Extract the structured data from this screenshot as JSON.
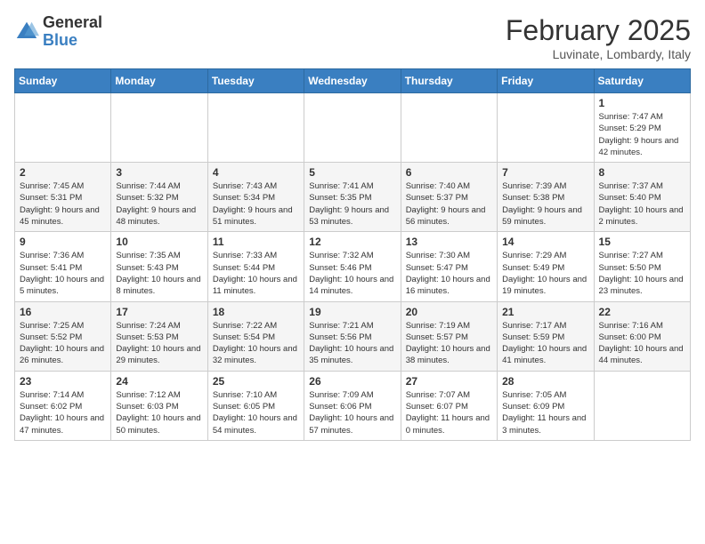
{
  "header": {
    "logo_general": "General",
    "logo_blue": "Blue",
    "title": "February 2025",
    "subtitle": "Luvinate, Lombardy, Italy"
  },
  "weekdays": [
    "Sunday",
    "Monday",
    "Tuesday",
    "Wednesday",
    "Thursday",
    "Friday",
    "Saturday"
  ],
  "weeks": [
    [
      {
        "day": "",
        "info": ""
      },
      {
        "day": "",
        "info": ""
      },
      {
        "day": "",
        "info": ""
      },
      {
        "day": "",
        "info": ""
      },
      {
        "day": "",
        "info": ""
      },
      {
        "day": "",
        "info": ""
      },
      {
        "day": "1",
        "info": "Sunrise: 7:47 AM\nSunset: 5:29 PM\nDaylight: 9 hours and 42 minutes."
      }
    ],
    [
      {
        "day": "2",
        "info": "Sunrise: 7:45 AM\nSunset: 5:31 PM\nDaylight: 9 hours and 45 minutes."
      },
      {
        "day": "3",
        "info": "Sunrise: 7:44 AM\nSunset: 5:32 PM\nDaylight: 9 hours and 48 minutes."
      },
      {
        "day": "4",
        "info": "Sunrise: 7:43 AM\nSunset: 5:34 PM\nDaylight: 9 hours and 51 minutes."
      },
      {
        "day": "5",
        "info": "Sunrise: 7:41 AM\nSunset: 5:35 PM\nDaylight: 9 hours and 53 minutes."
      },
      {
        "day": "6",
        "info": "Sunrise: 7:40 AM\nSunset: 5:37 PM\nDaylight: 9 hours and 56 minutes."
      },
      {
        "day": "7",
        "info": "Sunrise: 7:39 AM\nSunset: 5:38 PM\nDaylight: 9 hours and 59 minutes."
      },
      {
        "day": "8",
        "info": "Sunrise: 7:37 AM\nSunset: 5:40 PM\nDaylight: 10 hours and 2 minutes."
      }
    ],
    [
      {
        "day": "9",
        "info": "Sunrise: 7:36 AM\nSunset: 5:41 PM\nDaylight: 10 hours and 5 minutes."
      },
      {
        "day": "10",
        "info": "Sunrise: 7:35 AM\nSunset: 5:43 PM\nDaylight: 10 hours and 8 minutes."
      },
      {
        "day": "11",
        "info": "Sunrise: 7:33 AM\nSunset: 5:44 PM\nDaylight: 10 hours and 11 minutes."
      },
      {
        "day": "12",
        "info": "Sunrise: 7:32 AM\nSunset: 5:46 PM\nDaylight: 10 hours and 14 minutes."
      },
      {
        "day": "13",
        "info": "Sunrise: 7:30 AM\nSunset: 5:47 PM\nDaylight: 10 hours and 16 minutes."
      },
      {
        "day": "14",
        "info": "Sunrise: 7:29 AM\nSunset: 5:49 PM\nDaylight: 10 hours and 19 minutes."
      },
      {
        "day": "15",
        "info": "Sunrise: 7:27 AM\nSunset: 5:50 PM\nDaylight: 10 hours and 23 minutes."
      }
    ],
    [
      {
        "day": "16",
        "info": "Sunrise: 7:25 AM\nSunset: 5:52 PM\nDaylight: 10 hours and 26 minutes."
      },
      {
        "day": "17",
        "info": "Sunrise: 7:24 AM\nSunset: 5:53 PM\nDaylight: 10 hours and 29 minutes."
      },
      {
        "day": "18",
        "info": "Sunrise: 7:22 AM\nSunset: 5:54 PM\nDaylight: 10 hours and 32 minutes."
      },
      {
        "day": "19",
        "info": "Sunrise: 7:21 AM\nSunset: 5:56 PM\nDaylight: 10 hours and 35 minutes."
      },
      {
        "day": "20",
        "info": "Sunrise: 7:19 AM\nSunset: 5:57 PM\nDaylight: 10 hours and 38 minutes."
      },
      {
        "day": "21",
        "info": "Sunrise: 7:17 AM\nSunset: 5:59 PM\nDaylight: 10 hours and 41 minutes."
      },
      {
        "day": "22",
        "info": "Sunrise: 7:16 AM\nSunset: 6:00 PM\nDaylight: 10 hours and 44 minutes."
      }
    ],
    [
      {
        "day": "23",
        "info": "Sunrise: 7:14 AM\nSunset: 6:02 PM\nDaylight: 10 hours and 47 minutes."
      },
      {
        "day": "24",
        "info": "Sunrise: 7:12 AM\nSunset: 6:03 PM\nDaylight: 10 hours and 50 minutes."
      },
      {
        "day": "25",
        "info": "Sunrise: 7:10 AM\nSunset: 6:05 PM\nDaylight: 10 hours and 54 minutes."
      },
      {
        "day": "26",
        "info": "Sunrise: 7:09 AM\nSunset: 6:06 PM\nDaylight: 10 hours and 57 minutes."
      },
      {
        "day": "27",
        "info": "Sunrise: 7:07 AM\nSunset: 6:07 PM\nDaylight: 11 hours and 0 minutes."
      },
      {
        "day": "28",
        "info": "Sunrise: 7:05 AM\nSunset: 6:09 PM\nDaylight: 11 hours and 3 minutes."
      },
      {
        "day": "",
        "info": ""
      }
    ]
  ]
}
